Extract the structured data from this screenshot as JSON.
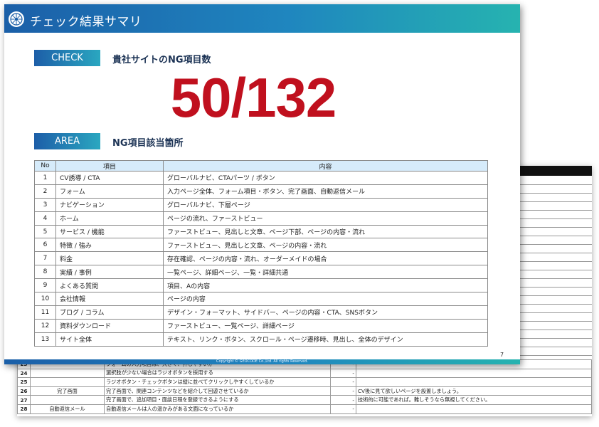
{
  "slide": {
    "title": "チェック結果サマリ",
    "check_label": "CHECK",
    "check_title": "貴社サイトのNG項目数",
    "score": "50/132",
    "area_label": "AREA",
    "area_title": "NG項目該当箇所",
    "table": {
      "headers": [
        "No",
        "項目",
        "内容"
      ],
      "rows": [
        {
          "no": "1",
          "category": "CV誘導 / CTA",
          "detail": "グローバルナビ、CTAパーツ / ボタン"
        },
        {
          "no": "2",
          "category": "フォーム",
          "detail": "入力ページ全体、フォーム項目・ボタン、完了画面、自動返信メール"
        },
        {
          "no": "3",
          "category": "ナビゲーション",
          "detail": "グローバルナビ、下層ページ"
        },
        {
          "no": "4",
          "category": "ホーム",
          "detail": "ページの流れ、ファーストビュー"
        },
        {
          "no": "5",
          "category": "サービス / 機能",
          "detail": "ファーストビュー、見出しと文章、ページ下部、ページの内容・流れ"
        },
        {
          "no": "6",
          "category": "特徴 / 強み",
          "detail": "ファーストビュー、見出しと文章、ページの内容・流れ"
        },
        {
          "no": "7",
          "category": "料金",
          "detail": "存在確認、ページの内容・流れ、オーダーメイドの場合"
        },
        {
          "no": "8",
          "category": "実績 / 事例",
          "detail": "一覧ページ、詳細ページ、一覧・詳細共通"
        },
        {
          "no": "9",
          "category": "よくある質問",
          "detail": "項目、Aの内容"
        },
        {
          "no": "10",
          "category": "会社情報",
          "detail": "ページの内容"
        },
        {
          "no": "11",
          "category": "ブログ / コラム",
          "detail": "デザイン・フォーマット、サイドバー、ページの内容・CTA、SNSボタン"
        },
        {
          "no": "12",
          "category": "資料ダウンロード",
          "detail": "ファーストビュー、一覧ページ、詳細ページ"
        },
        {
          "no": "13",
          "category": "サイト全体",
          "detail": "テキスト、リンク・ボタン、スクロール・ページ遷移時、見出し、全体のデザイン"
        }
      ]
    },
    "copyright": "Copyright © GEOCODE Co.,Ltd. All rights Reserved.",
    "page_number": "7"
  },
  "back_sheet": {
    "rows": [
      {
        "no": "23",
        "sub": "",
        "item": "フォームの入力項目は、大きく、押しやすいか",
        "dd": "-",
        "note": ""
      },
      {
        "no": "24",
        "sub": "",
        "item": "選択肢が少ない場合はラジオボタンを採用する",
        "dd": "-",
        "note": ""
      },
      {
        "no": "25",
        "sub": "",
        "item": "ラジオボタン・チェックボタンは縦に並べてクリックしやすくしているか",
        "dd": "-",
        "note": ""
      },
      {
        "no": "26",
        "sub": "完了画面",
        "item": "完了画面で、関連コンテンツなどを紹介して回遊させているか",
        "dd": "-",
        "note": "CV後に見て欲しいページを設置しましょう。"
      },
      {
        "no": "27",
        "sub": "",
        "item": "完了画面で、追加項目・面談日程を登録できるようにする",
        "dd": "-",
        "note": "技術的に可能であれば。難しそうなら無視してください。"
      },
      {
        "no": "28",
        "sub": "自動返信メール",
        "item": "自動返信メールは人の温かみがある文面になっているか",
        "dd": "-",
        "note": ""
      }
    ]
  },
  "colors": {
    "header_gradient_start": "#1b5fa8",
    "header_gradient_end": "#26b3b0",
    "score_red": "#c0101e",
    "table_header_bg": "#d6ebfa",
    "section_title": "#1c3355"
  },
  "icons": {
    "logo": "logo-icon"
  }
}
